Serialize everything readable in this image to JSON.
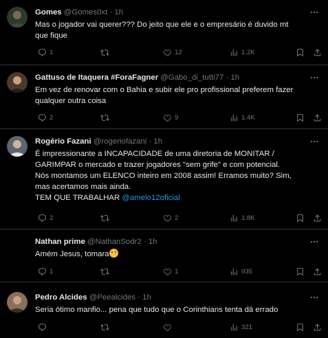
{
  "tweets": [
    {
      "name": "Gomes",
      "handle": "@Gomes0xt",
      "time": "1h",
      "lines": [
        "Mas o jogador vai querer??? Do jeito que ele e o empresário é duvido mt",
        "que fique"
      ],
      "replies": "1",
      "retweets": "",
      "likes": "12",
      "views": "1.2K"
    },
    {
      "name": "Gattuso de Itaquera #ForaFagner",
      "handle": "@Gabo_di_tutti77",
      "time": "1h",
      "lines": [
        "Em vez de renovar com o Bahia e subir ele pro profissional preferem fazer",
        "qualquer outra coisa"
      ],
      "replies": "2",
      "retweets": "",
      "likes": "9",
      "views": "1.4K"
    },
    {
      "name": "Rogério Fazani",
      "handle": "@rogeriofazani",
      "time": "1h",
      "lines": [
        "É impressionante a INCAPACIDADE de uma diretoria de MONITAR /",
        "GARIMPAR o mercado e trazer jogadores \"sem grife\" e com potencial.",
        "Nós montamos um ELENCO inteiro em 2008 assim! Erramos muito? Sim,",
        "mas acertamos mais ainda."
      ],
      "last_line_prefix": "TEM QUE TRABALHAR ",
      "last_line_mention": "@amelo12oficial",
      "replies": "2",
      "retweets": "",
      "likes": "2",
      "views": "1.8K"
    },
    {
      "name": "Nathan prime",
      "handle": "@NathanSodr2",
      "time": "1h",
      "lines": [
        "Amém Jesus, tomara"
      ],
      "replies": "1",
      "retweets": "",
      "likes": "1",
      "views": "935"
    },
    {
      "name": "Pedro Alcides",
      "handle": "@Peealcides",
      "time": "1h",
      "lines": [
        "Seria ótimo manfio... pena que tudo que o Corinthians tenta dá errado"
      ],
      "replies": "",
      "retweets": "",
      "likes": "",
      "views": "321"
    }
  ],
  "separator": "·",
  "icons": [
    "more-icon",
    "reply-icon",
    "retweet-icon",
    "like-icon",
    "views-icon",
    "bookmark-icon",
    "share-icon"
  ],
  "colors": {
    "background": "#000000",
    "text": "#e7e9ea",
    "muted": "#71767b",
    "link": "#1d9bf0",
    "border": "#2f3336"
  }
}
